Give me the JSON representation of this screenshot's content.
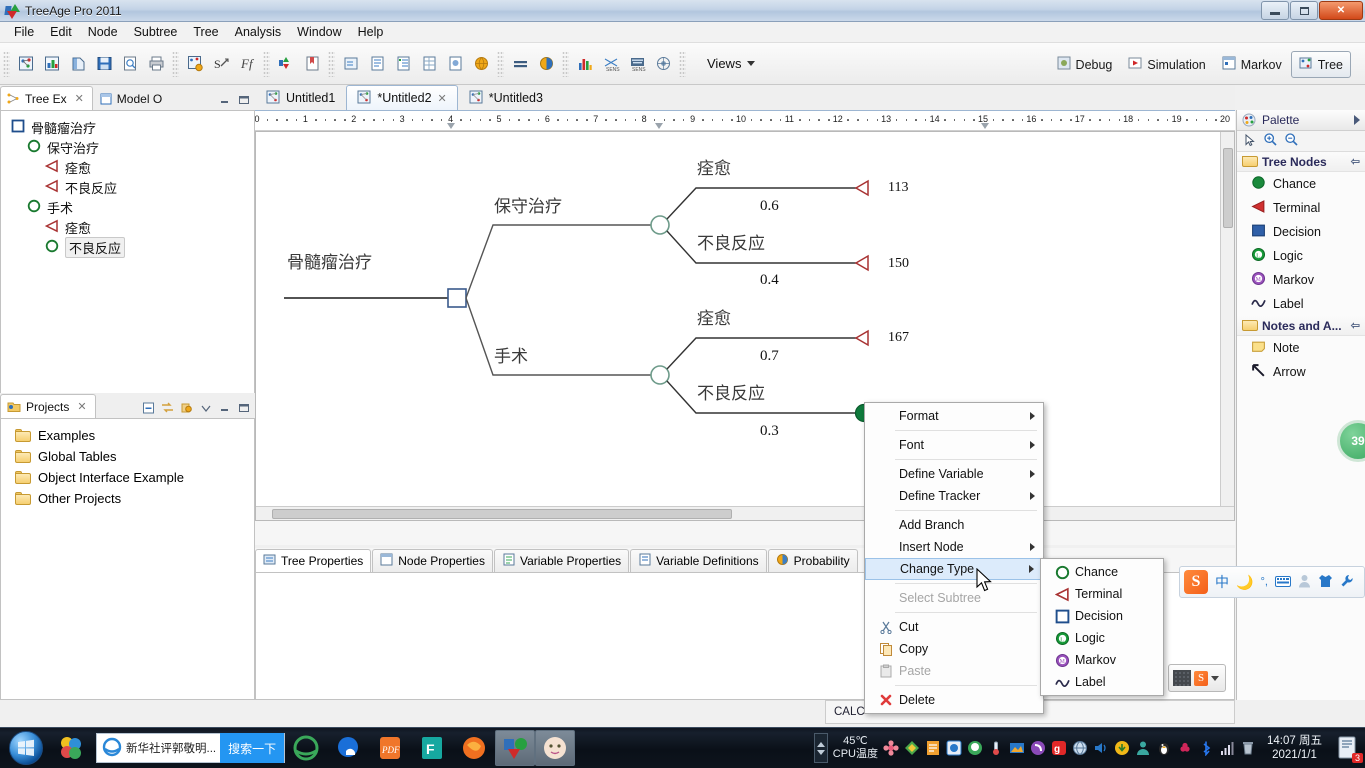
{
  "window": {
    "title": "TreeAge Pro 2011",
    "minimize_label": "_",
    "maximize_label": "❐",
    "close_label": "✕"
  },
  "menubar": {
    "items": [
      "File",
      "Edit",
      "Node",
      "Subtree",
      "Tree",
      "Analysis",
      "Window",
      "Help"
    ]
  },
  "toolbar": {
    "views_label": "Views",
    "perspectives": [
      {
        "label": "Debug",
        "active": false
      },
      {
        "label": "Simulation",
        "active": false
      },
      {
        "label": "Markov",
        "active": false
      },
      {
        "label": "Tree",
        "active": true
      }
    ]
  },
  "left_panel": {
    "tabs": [
      {
        "label": "Tree Ex",
        "active": true,
        "closable": true
      },
      {
        "label": "Model O",
        "active": false,
        "closable": false
      }
    ],
    "tree_nodes": [
      {
        "label": "骨髓瘤治疗",
        "type": "decision",
        "indent": 0,
        "selected": false
      },
      {
        "label": "保守治疗",
        "type": "chance",
        "indent": 1,
        "selected": false
      },
      {
        "label": "痊愈",
        "type": "terminal",
        "indent": 2,
        "selected": false
      },
      {
        "label": "不良反应",
        "type": "terminal",
        "indent": 2,
        "selected": false
      },
      {
        "label": "手术",
        "type": "chance",
        "indent": 1,
        "selected": false
      },
      {
        "label": "痊愈",
        "type": "terminal",
        "indent": 2,
        "selected": false
      },
      {
        "label": "不良反应",
        "type": "chance",
        "indent": 2,
        "selected": true
      }
    ]
  },
  "projects_panel": {
    "tab_label": "Projects",
    "items": [
      "Examples",
      "Global Tables",
      "Object Interface Example",
      "Other Projects"
    ]
  },
  "editor": {
    "tabs": [
      {
        "label": "Untitled1",
        "active": false,
        "closable": false
      },
      {
        "label": "*Untitled2",
        "active": true,
        "closable": true
      },
      {
        "label": "*Untitled3",
        "active": false,
        "closable": false
      }
    ],
    "ruler_ticks": [
      "0",
      "1",
      "2",
      "3",
      "4",
      "5",
      "6",
      "7",
      "8",
      "9",
      "10",
      "11",
      "12",
      "13",
      "14",
      "15",
      "16",
      "17",
      "18",
      "19",
      "20"
    ]
  },
  "tree_diagram": {
    "root_label": "骨髓瘤治疗",
    "branches": [
      {
        "label": "保守治疗",
        "children": [
          {
            "label": "痊愈",
            "probability": "0.6",
            "payoff": "113"
          },
          {
            "label": "不良反应",
            "probability": "0.4",
            "payoff": "150"
          }
        ]
      },
      {
        "label": "手术",
        "children": [
          {
            "label": "痊愈",
            "probability": "0.7",
            "payoff": "167"
          },
          {
            "label": "不良反应",
            "probability": "0.3",
            "payoff": ""
          }
        ]
      }
    ]
  },
  "bottom_tabs": [
    {
      "label": "Tree Properties",
      "active": true
    },
    {
      "label": "Node Properties",
      "active": false
    },
    {
      "label": "Variable Properties",
      "active": false
    },
    {
      "label": "Variable Definitions",
      "active": false
    },
    {
      "label": "Probability",
      "active": false
    }
  ],
  "palette": {
    "title": "Palette",
    "tools": [
      "select-tool",
      "zoom-in-tool",
      "zoom-out-tool"
    ],
    "groups": [
      {
        "title": "Tree Nodes",
        "items": [
          {
            "label": "Chance",
            "icon": "chance-node-icon"
          },
          {
            "label": "Terminal",
            "icon": "terminal-node-icon"
          },
          {
            "label": "Decision",
            "icon": "decision-node-icon"
          },
          {
            "label": "Logic",
            "icon": "logic-node-icon"
          },
          {
            "label": "Markov",
            "icon": "markov-node-icon"
          },
          {
            "label": "Label",
            "icon": "label-node-icon"
          }
        ]
      },
      {
        "title": "Notes and A...",
        "items": [
          {
            "label": "Note",
            "icon": "note-icon"
          },
          {
            "label": "Arrow",
            "icon": "arrow-icon"
          }
        ]
      }
    ]
  },
  "context_menu": {
    "items": [
      {
        "label": "Format",
        "submenu": true,
        "disabled": false,
        "highlighted": false,
        "icon": ""
      },
      {
        "label": "Font",
        "submenu": true,
        "disabled": false,
        "highlighted": false,
        "icon": ""
      },
      {
        "label": "Define Variable",
        "submenu": true,
        "disabled": false,
        "highlighted": false,
        "icon": ""
      },
      {
        "label": "Define Tracker",
        "submenu": true,
        "disabled": false,
        "highlighted": false,
        "icon": ""
      },
      {
        "label": "Add Branch",
        "submenu": false,
        "disabled": false,
        "highlighted": false,
        "icon": ""
      },
      {
        "label": "Insert Node",
        "submenu": true,
        "disabled": false,
        "highlighted": false,
        "icon": ""
      },
      {
        "label": "Change Type",
        "submenu": true,
        "disabled": false,
        "highlighted": true,
        "icon": ""
      },
      {
        "label": "Select Subtree",
        "submenu": false,
        "disabled": true,
        "highlighted": false,
        "icon": ""
      },
      {
        "label": "Cut",
        "submenu": false,
        "disabled": false,
        "highlighted": false,
        "icon": "cut-icon"
      },
      {
        "label": "Copy",
        "submenu": false,
        "disabled": false,
        "highlighted": false,
        "icon": "copy-icon"
      },
      {
        "label": "Paste",
        "submenu": false,
        "disabled": true,
        "highlighted": false,
        "icon": "paste-icon"
      },
      {
        "label": "Delete",
        "submenu": false,
        "disabled": false,
        "highlighted": false,
        "icon": "delete-icon"
      }
    ],
    "submenu": {
      "items": [
        {
          "label": "Chance",
          "icon": "chance-node-icon"
        },
        {
          "label": "Terminal",
          "icon": "terminal-node-icon"
        },
        {
          "label": "Decision",
          "icon": "decision-node-icon"
        },
        {
          "label": "Logic",
          "icon": "logic-node-icon"
        },
        {
          "label": "Markov",
          "icon": "markov-node-icon"
        },
        {
          "label": "Label",
          "icon": "label-node-icon"
        }
      ]
    }
  },
  "status": {
    "calc_text": "CALC"
  },
  "floating_badge": {
    "value": "39"
  },
  "ime": {
    "logo": "S",
    "mode_label": "中",
    "icons": [
      "moon-icon",
      "punctuation-icon",
      "keyboard-icon",
      "user-icon",
      "skin-icon",
      "tools-icon"
    ]
  },
  "taskbar": {
    "search_text": "新华社评郭敬明...",
    "search_button": "搜索一下",
    "tray": {
      "temperature": "45℃",
      "temperature_label": "CPU温度",
      "time": "14:07 周五",
      "date": "2021/1/1",
      "badge_count": "3"
    }
  },
  "colors": {
    "chance_green": "#19792f",
    "terminal_red": "#a83232",
    "decision_blue": "#1f4e8c",
    "logic_green": "#13862c",
    "markov_purple": "#8e4ba8",
    "accent_blue": "#2496f2",
    "selected_node_green": "#0f7a3c"
  }
}
